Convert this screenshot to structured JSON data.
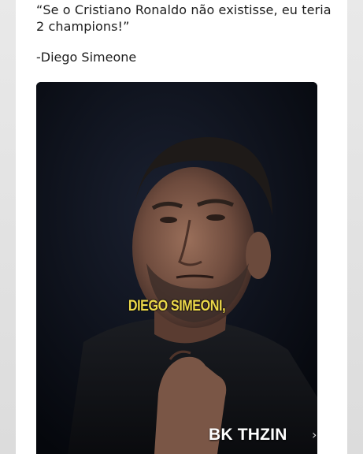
{
  "post": {
    "quote": "“Se o Cristiano Ronaldo não existisse, eu teria 2 champions!”",
    "author": "-Diego Simeone"
  },
  "video": {
    "caption": "DIEGO SIMEONI,",
    "watermark": "BK THZIN",
    "chevron_icon": "chevron-right-icon",
    "caption_color": "#ecd84a"
  }
}
